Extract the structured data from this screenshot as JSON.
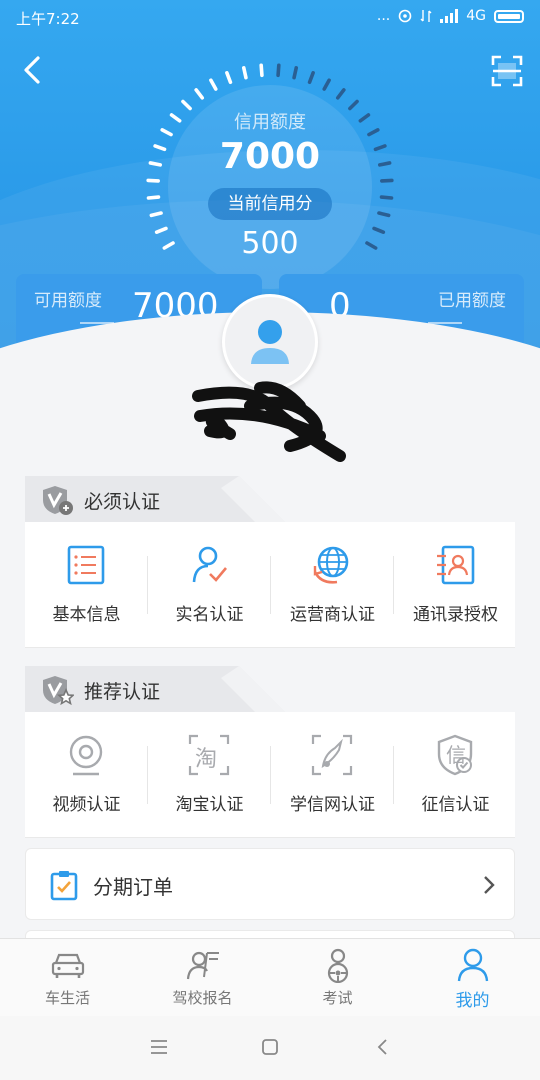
{
  "status_bar": {
    "time": "上午7:22",
    "dots": "...",
    "network": "4G"
  },
  "header": {
    "credit_limit_label": "信用额度",
    "credit_limit_value": "7000",
    "credit_score_label": "当前信用分",
    "credit_score_value": "500"
  },
  "quota": {
    "available_label": "可用额度",
    "available_value": "7000",
    "used_label": "已用额度",
    "used_value": "0"
  },
  "required_section": {
    "title": "必须认证",
    "items": [
      {
        "label": "基本信息",
        "icon": "list-form-icon"
      },
      {
        "label": "实名认证",
        "icon": "user-check-icon"
      },
      {
        "label": "运营商认证",
        "icon": "globe-icon"
      },
      {
        "label": "通讯录授权",
        "icon": "contacts-icon"
      }
    ]
  },
  "recommended_section": {
    "title": "推荐认证",
    "items": [
      {
        "label": "视频认证",
        "icon": "camera-icon"
      },
      {
        "label": "淘宝认证",
        "icon": "taobao-icon",
        "glyph": "淘"
      },
      {
        "label": "学信网认证",
        "icon": "graduation-icon"
      },
      {
        "label": "征信认证",
        "icon": "credit-shield-icon",
        "glyph": "信"
      }
    ]
  },
  "order": {
    "label": "分期订单"
  },
  "bottom_nav": {
    "items": [
      {
        "label": "车生活",
        "icon": "car-icon",
        "active": false
      },
      {
        "label": "驾校报名",
        "icon": "driving-school-icon",
        "active": false
      },
      {
        "label": "考试",
        "icon": "exam-icon",
        "active": false
      },
      {
        "label": "我的",
        "icon": "profile-icon",
        "active": true
      }
    ]
  },
  "colors": {
    "primary": "#2e9bea",
    "header": "#35a8f0",
    "text": "#333333",
    "muted": "#777777"
  }
}
